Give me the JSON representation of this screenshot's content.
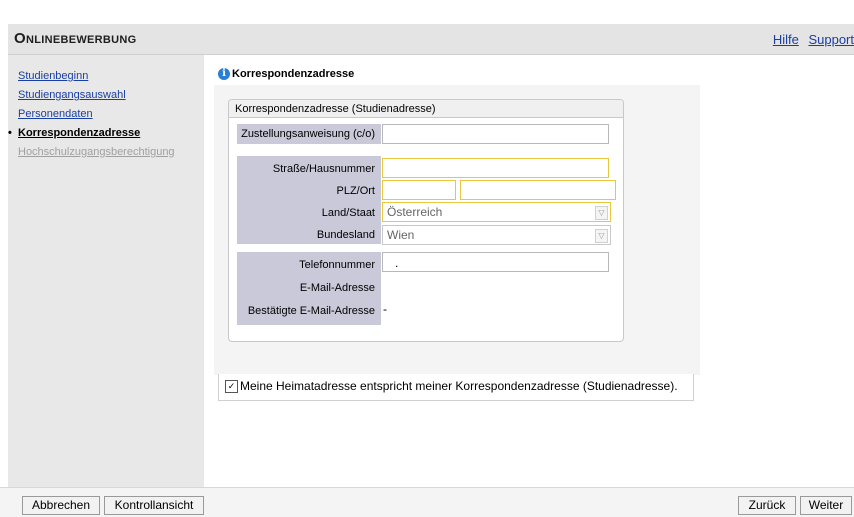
{
  "header": {
    "title": "Onlinebewerbung",
    "help_link": "Hilfe",
    "support_link": "Support"
  },
  "sidebar": {
    "items": [
      {
        "label": "Studienbeginn",
        "state": "link"
      },
      {
        "label": "Studiengangsauswahl",
        "state": "link"
      },
      {
        "label": "Personendaten",
        "state": "link"
      },
      {
        "label": "Korrespondenzadresse",
        "state": "active"
      },
      {
        "label": "Hochschulzugangsberechtigung",
        "state": "disabled"
      }
    ]
  },
  "tab": {
    "label": "Korrespondenzadresse",
    "icon": "info-icon"
  },
  "form": {
    "legend": "Korrespondenzadresse (Studienadresse)",
    "fields": {
      "care_of": {
        "label": "Zustellungsanweisung (c/o)",
        "value": ""
      },
      "street": {
        "label": "Straße/Hausnummer",
        "value": ""
      },
      "plz_ort": {
        "label": "PLZ/Ort",
        "plz": "",
        "ort": ""
      },
      "country": {
        "label": "Land/Staat",
        "value": "Österreich"
      },
      "state": {
        "label": "Bundesland",
        "value": "Wien"
      },
      "phone": {
        "label": "Telefonnummer",
        "value": "."
      },
      "email": {
        "label": "E-Mail-Adresse",
        "value": ""
      },
      "email_confirmed": {
        "label": "Bestätigte E-Mail-Adresse",
        "value": "-"
      }
    },
    "checkbox": {
      "label": "Meine Heimatadresse entspricht meiner Korrespondenzadresse (Studienadresse).",
      "checked": true,
      "mark": "☑"
    }
  },
  "buttons": {
    "cancel": "Abbrechen",
    "overview": "Kontrollansicht",
    "back": "Zurück",
    "next": "Weiter"
  },
  "colors": {
    "link": "#1a3fa3",
    "required_border": "#e8c840",
    "label_bg": "#c9c9d9",
    "info_icon": "#2a7fd4"
  }
}
